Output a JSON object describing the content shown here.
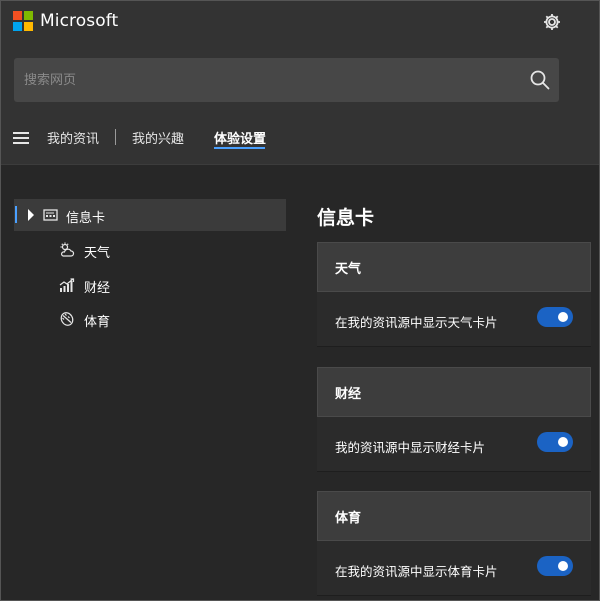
{
  "header": {
    "brand": "Microsoft",
    "logo_colors": [
      "#f25022",
      "#7fba00",
      "#00a4ef",
      "#ffb900"
    ],
    "settings_icon": "gear-icon"
  },
  "search": {
    "placeholder": "搜索网页",
    "icon": "search-icon"
  },
  "nav": {
    "menu_icon": "hamburger-icon",
    "items": [
      {
        "label": "我的资讯"
      },
      {
        "label": "我的兴趣"
      },
      {
        "label": "体验设置",
        "active": true
      }
    ]
  },
  "sidebar": {
    "items": [
      {
        "label": "信息卡",
        "icon": "card-icon",
        "selected": true
      },
      {
        "label": "天气",
        "icon": "weather-icon"
      },
      {
        "label": "财经",
        "icon": "finance-icon"
      },
      {
        "label": "体育",
        "icon": "sports-icon"
      }
    ]
  },
  "main": {
    "title": "信息卡",
    "cards": [
      {
        "title": "天气",
        "setting": "在我的资讯源中显示天气卡片",
        "enabled": true
      },
      {
        "title": "财经",
        "setting": "我的资讯源中显示财经卡片",
        "enabled": true
      },
      {
        "title": "体育",
        "setting": "在我的资讯源中显示体育卡片",
        "enabled": true
      }
    ]
  },
  "colors": {
    "accent": "#4aa0ff",
    "toggle_on": "#1b63c4",
    "background": "#272727",
    "header_bg": "#333333"
  }
}
